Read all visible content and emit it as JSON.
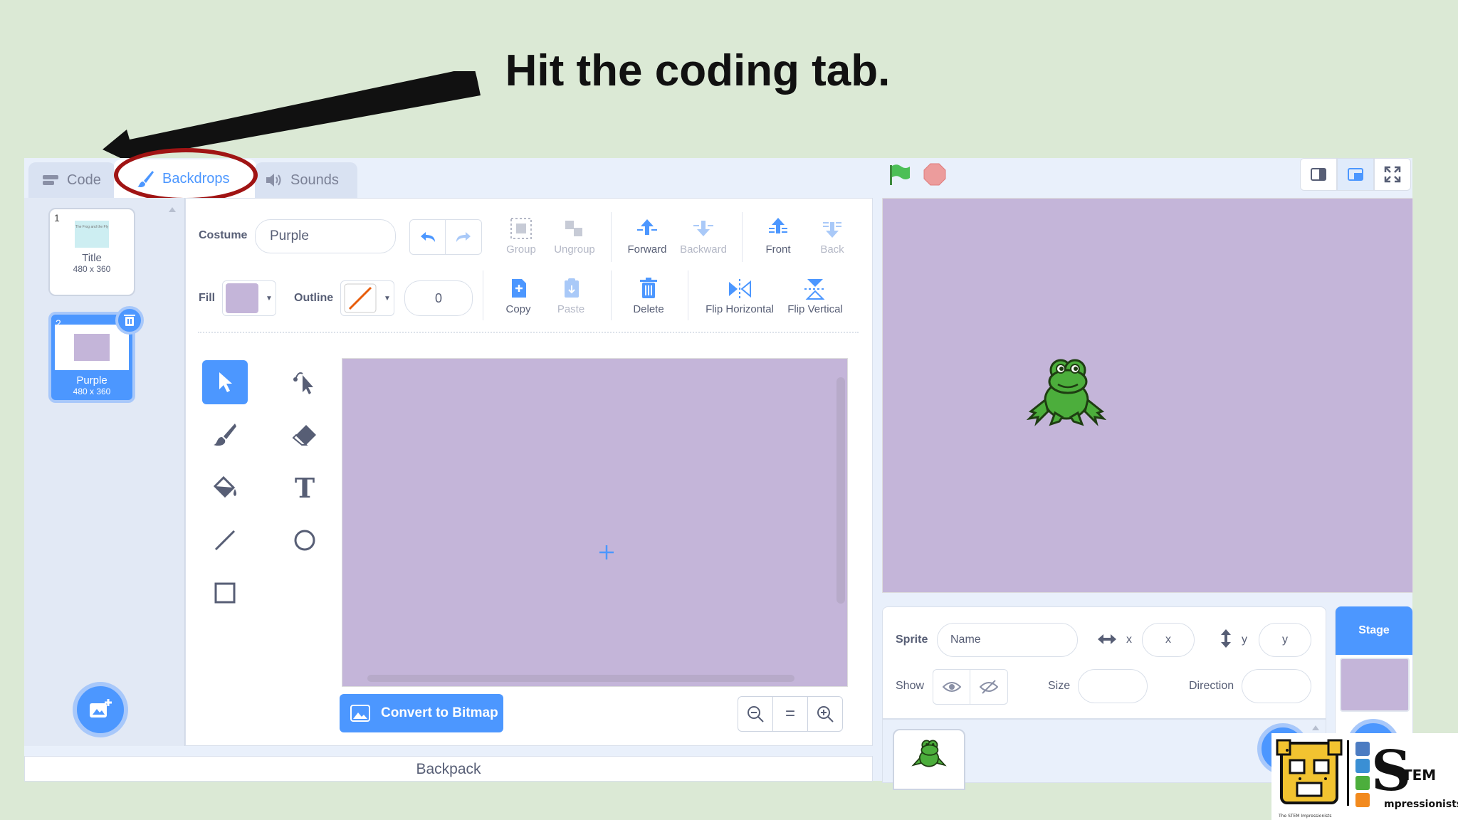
{
  "annotation": {
    "headline": "Hit the coding tab."
  },
  "tabs": {
    "code": "Code",
    "backdrops": "Backdrops",
    "sounds": "Sounds"
  },
  "backdrops": [
    {
      "number": "1",
      "name": "Title",
      "size": "480 x 360",
      "preview_text": "The Frog and the Fly",
      "selected": false
    },
    {
      "number": "2",
      "name": "Purple",
      "size": "480 x 360",
      "selected": true
    }
  ],
  "editor": {
    "costume_label": "Costume",
    "costume_name": "Purple",
    "fill_label": "Fill",
    "fill_color": "#c4b5d9",
    "outline_label": "Outline",
    "outline_width": "0",
    "toolbar": {
      "group": "Group",
      "ungroup": "Ungroup",
      "forward": "Forward",
      "backward": "Backward",
      "front": "Front",
      "back": "Back",
      "copy": "Copy",
      "paste": "Paste",
      "delete": "Delete",
      "flip_horizontal": "Flip Horizontal",
      "flip_vertical": "Flip Vertical"
    },
    "convert_button": "Convert to Bitmap",
    "zoom_equal": "="
  },
  "backpack": "Backpack",
  "sprite_info": {
    "sprite_label": "Sprite",
    "name_placeholder": "Name",
    "x_label": "x",
    "x_placeholder": "x",
    "y_label": "y",
    "y_placeholder": "y",
    "show_label": "Show",
    "size_label": "Size",
    "direction_label": "Direction"
  },
  "stage_panel": {
    "label": "Stage"
  },
  "colors": {
    "accent": "#4c97ff",
    "canvas": "#c4b5d9",
    "background": "#dbe9d5",
    "annotation_oval": "#a01414"
  },
  "logo": {
    "text": "The STEM Impressionists"
  }
}
